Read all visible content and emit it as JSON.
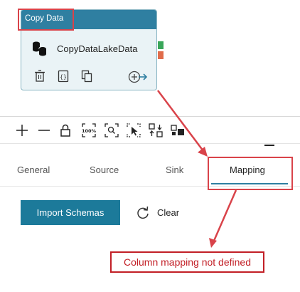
{
  "activity": {
    "type_label": "Copy Data",
    "name": "CopyDataLakeData"
  },
  "tabs": [
    {
      "label": "General"
    },
    {
      "label": "Source"
    },
    {
      "label": "Sink"
    },
    {
      "label": "Mapping",
      "active": true
    }
  ],
  "mapping": {
    "import_schemas_label": "Import Schemas",
    "clear_label": "Clear"
  },
  "annotation": {
    "note": "Column mapping not defined",
    "color": "#d9434a"
  },
  "colors": {
    "accent": "#2f7fa1",
    "success_port": "#3aa65a",
    "failure_port": "#e06c4b"
  },
  "icons": {
    "card": [
      "database-icon",
      "delete-icon",
      "code-icon",
      "copy-icon",
      "add-output-icon"
    ],
    "toolbar": [
      "zoom-in-icon",
      "zoom-out-icon",
      "lock-icon",
      "zoom-100-icon",
      "zoom-to-fit-icon",
      "select-icon",
      "auto-align-icon",
      "layout-icon"
    ]
  }
}
